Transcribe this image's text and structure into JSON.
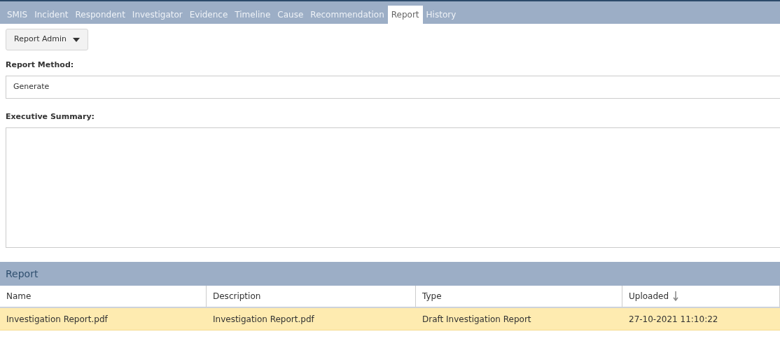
{
  "tabs": [
    {
      "label": "SMIS",
      "selected": false
    },
    {
      "label": "Incident",
      "selected": false
    },
    {
      "label": "Respondent",
      "selected": false
    },
    {
      "label": "Investigator",
      "selected": false
    },
    {
      "label": "Evidence",
      "selected": false
    },
    {
      "label": "Timeline",
      "selected": false
    },
    {
      "label": "Cause",
      "selected": false
    },
    {
      "label": "Recommendation",
      "selected": false
    },
    {
      "label": "Report",
      "selected": true
    },
    {
      "label": "History",
      "selected": false
    }
  ],
  "admin_button": {
    "label": "Report Admin"
  },
  "report_method": {
    "label": "Report Method:",
    "value": "Generate"
  },
  "executive_summary": {
    "label": "Executive Summary:"
  },
  "report_panel": {
    "title": "Report",
    "columns": [
      {
        "label": "Name",
        "sorted": false
      },
      {
        "label": "Description",
        "sorted": false
      },
      {
        "label": "Type",
        "sorted": false
      },
      {
        "label": "Uploaded",
        "sorted": true
      }
    ],
    "rows": [
      {
        "cells": [
          "Investigation Report.pdf",
          "Investigation Report.pdf",
          "Draft Investigation Report",
          "27-10-2021 11:10:22"
        ],
        "selected": true
      }
    ]
  }
}
